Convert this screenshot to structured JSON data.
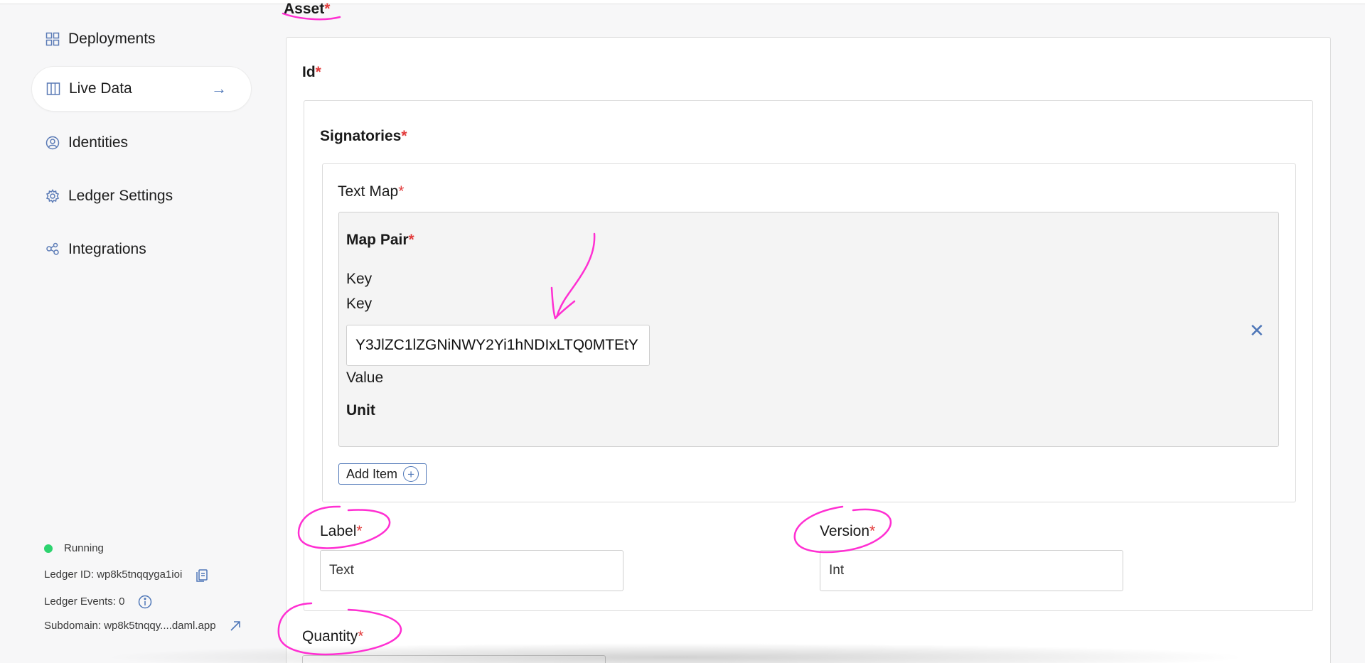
{
  "sidebar": {
    "items": [
      {
        "label": "Deployments",
        "icon": "grid-icon"
      },
      {
        "label": "Live Data",
        "icon": "columns-icon",
        "active": true
      },
      {
        "label": "Identities",
        "icon": "user-circle-icon"
      },
      {
        "label": "Ledger Settings",
        "icon": "gear-icon"
      },
      {
        "label": "Integrations",
        "icon": "nodes-icon"
      }
    ],
    "active_arrow": "→",
    "status": {
      "running": "Running",
      "ledger_id": "Ledger ID: wp8k5tnqqyga1ioi",
      "ledger_events": "Ledger Events: 0",
      "subdomain": "Subdomain: wp8k5tnqqy....daml.app"
    }
  },
  "form": {
    "asset_label": "Asset",
    "id_label": "Id",
    "signatories_label": "Signatories",
    "text_map_label": "Text Map",
    "map_pair_label": "Map Pair",
    "key_label_1": "Key",
    "key_label_2": "Key",
    "key_value": "Y3JlZC1lZGNiNWY2Yi1hNDIxLTQ0MTEtY",
    "value_label": "Value",
    "unit_label": "Unit",
    "remove_symbol": "✕",
    "add_item_label": "Add Item",
    "label_label": "Label",
    "label_placeholder": "Text",
    "version_label": "Version",
    "version_placeholder": "Int",
    "quantity_label": "Quantity",
    "required_mark": "*"
  },
  "colors": {
    "accent": "#4f77b8",
    "required": "#e23b3b",
    "running": "#2dd36f",
    "annotation": "#ff2fd2"
  }
}
